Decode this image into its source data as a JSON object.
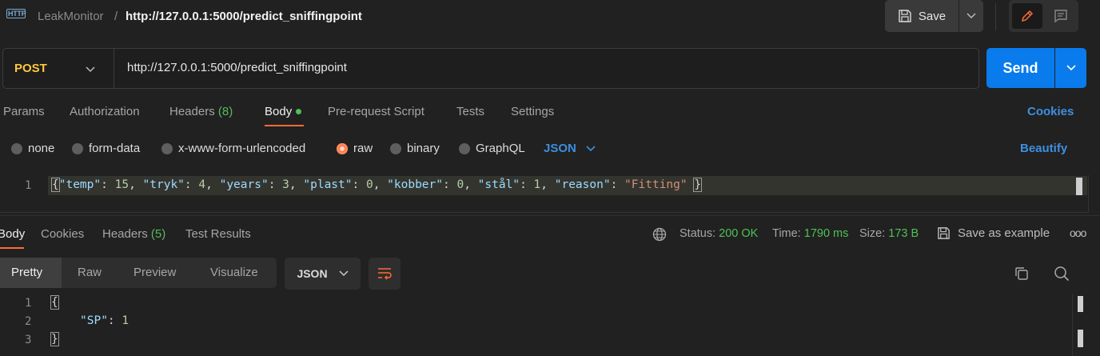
{
  "header": {
    "icon_text": "HTTP",
    "collection": "LeakMonitor",
    "separator": "/",
    "request_name": "http://127.0.0.1:5000/predict_sniffingpoint",
    "save_label": "Save"
  },
  "request": {
    "method": "POST",
    "url": "http://127.0.0.1:5000/predict_sniffingpoint",
    "send_label": "Send"
  },
  "tabs": {
    "params": "Params",
    "authorization": "Authorization",
    "headers": "Headers",
    "headers_count": "(8)",
    "body": "Body",
    "pre_request": "Pre-request Script",
    "tests": "Tests",
    "settings": "Settings",
    "cookies": "Cookies"
  },
  "body_types": {
    "none": "none",
    "form_data": "form-data",
    "urlencoded": "x-www-form-urlencoded",
    "raw": "raw",
    "binary": "binary",
    "graphql": "GraphQL",
    "selected": "raw",
    "language": "JSON",
    "beautify": "Beautify"
  },
  "request_body": {
    "line_number": "1",
    "open": "{",
    "close": "}",
    "fields": [
      {
        "key": "\"temp\"",
        "value": "15",
        "type": "number"
      },
      {
        "key": "\"tryk\"",
        "value": "4",
        "type": "number"
      },
      {
        "key": "\"years\"",
        "value": "3",
        "type": "number"
      },
      {
        "key": "\"plast\"",
        "value": "0",
        "type": "number"
      },
      {
        "key": "\"kobber\"",
        "value": "0",
        "type": "number"
      },
      {
        "key": "\"stål\"",
        "value": "1",
        "type": "number"
      },
      {
        "key": "\"reason\"",
        "value": "\"Fitting\"",
        "type": "string"
      }
    ]
  },
  "response_tabs": {
    "body": "Body",
    "cookies": "Cookies",
    "headers": "Headers",
    "headers_count": "(5)",
    "test_results": "Test Results"
  },
  "response_status": {
    "status_label": "Status:",
    "status_value": "200 OK",
    "time_label": "Time:",
    "time_value": "1790 ms",
    "size_label": "Size:",
    "size_value": "173 B",
    "save_example": "Save as example",
    "more": "ooo"
  },
  "response_view": {
    "pretty": "Pretty",
    "raw": "Raw",
    "preview": "Preview",
    "visualize": "Visualize",
    "format": "JSON"
  },
  "response_body": {
    "lines": [
      "1",
      "2",
      "3"
    ],
    "open": "{",
    "key": "\"SP\"",
    "value": "1",
    "close": "}"
  },
  "colors": {
    "accent_orange": "#ff6c37",
    "link_blue": "#3d8fe0",
    "send_blue": "#097bed",
    "status_green": "#4cc255",
    "method_yellow": "#ffc83d"
  }
}
